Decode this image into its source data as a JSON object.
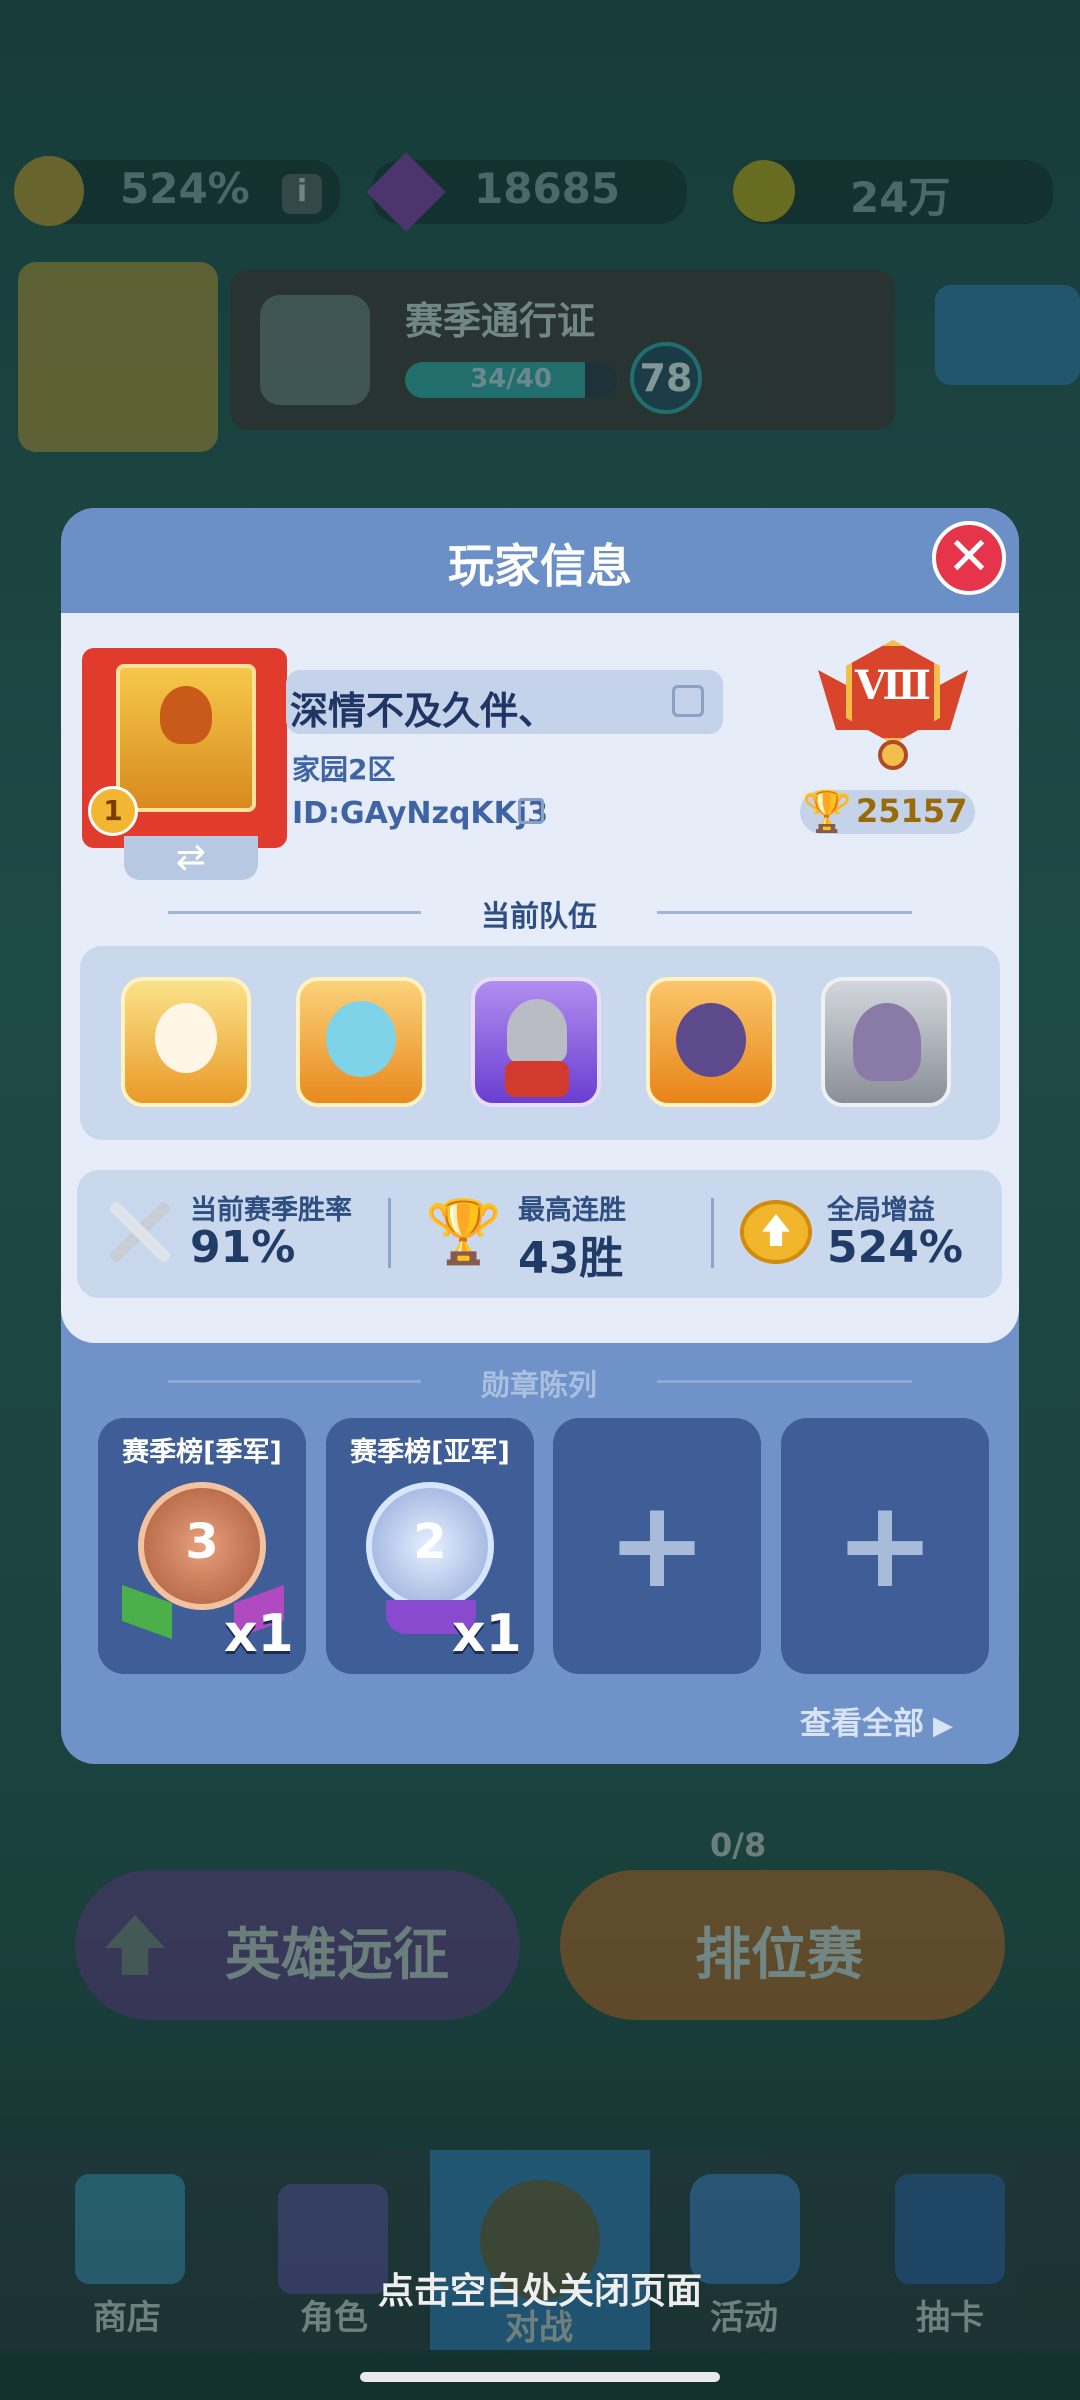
{
  "resources": {
    "boost_percent": "524%",
    "gems": "18685",
    "coins": "24万"
  },
  "season_pass": {
    "title": "赛季通行证",
    "progress_text": "34/40",
    "progress": 0.85,
    "level": "78"
  },
  "modal": {
    "title": "玩家信息",
    "player": {
      "name": "深情不及久伴、",
      "server": "家园2区",
      "id_text": "ID:GAyNzqKKj3",
      "rank_numeral": "Ⅷ",
      "trophies": "25157",
      "avatar_badge": "1"
    },
    "team_section_label": "当前队伍",
    "team_heroes": [
      "angel-hero",
      "ice-mage-hero",
      "knight-hero",
      "dark-warrior-hero",
      "ghost-hero"
    ],
    "stats": [
      {
        "label": "当前赛季胜率",
        "value": "91%",
        "icon": "crossed-swords-icon"
      },
      {
        "label": "最高连胜",
        "value": "43胜",
        "icon": "trophy-icon"
      },
      {
        "label": "全局增益",
        "value": "524%",
        "icon": "boost-icon"
      }
    ],
    "medal_section_label": "勋章陈列",
    "medals": [
      {
        "title": "赛季榜[季军]",
        "count": "x1",
        "rank": "3"
      },
      {
        "title": "赛季榜[亚军]",
        "count": "x1",
        "rank": "2"
      }
    ],
    "empty_slots": [
      "+",
      "+"
    ],
    "view_all": "查看全部"
  },
  "background": {
    "expedition": "英雄远征",
    "ranked": "排位赛",
    "ranked_tickets": "0/8"
  },
  "bottom_nav": [
    "商店",
    "角色",
    "对战",
    "活动",
    "抽卡"
  ],
  "close_hint": "点击空白处关闭页面",
  "colors": {
    "modal_blue": "#6f93c8",
    "panel": "#e6edf8",
    "close_red": "#e6344a",
    "gold": "#f2b632"
  }
}
